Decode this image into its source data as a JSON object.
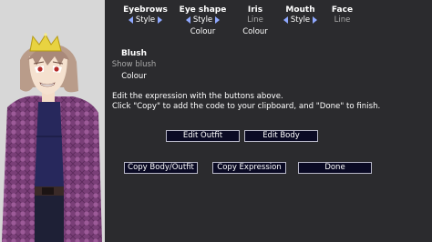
{
  "controls": {
    "eyebrows": {
      "title": "Eyebrows",
      "value": "Style"
    },
    "eye_shape": {
      "title": "Eye shape",
      "value": "Style",
      "colour": "Colour"
    },
    "iris": {
      "title": "Iris",
      "value": "Line",
      "colour": "Colour"
    },
    "mouth": {
      "title": "Mouth",
      "value": "Style"
    },
    "face": {
      "title": "Face",
      "value": "Line"
    },
    "blush": {
      "title": "Blush",
      "value": "Show blush",
      "colour": "Colour"
    }
  },
  "help": {
    "line1": "Edit the expression with the buttons above.",
    "line2": "Click \"Copy\" to add the code to your clipboard, and \"Done\" to finish."
  },
  "buttons": {
    "edit_outfit": "Edit Outfit",
    "edit_body": "Edit Body",
    "copy_body_outfit": "Copy Body/Outfit",
    "copy_expression": "Copy Expression",
    "done": "Done"
  }
}
